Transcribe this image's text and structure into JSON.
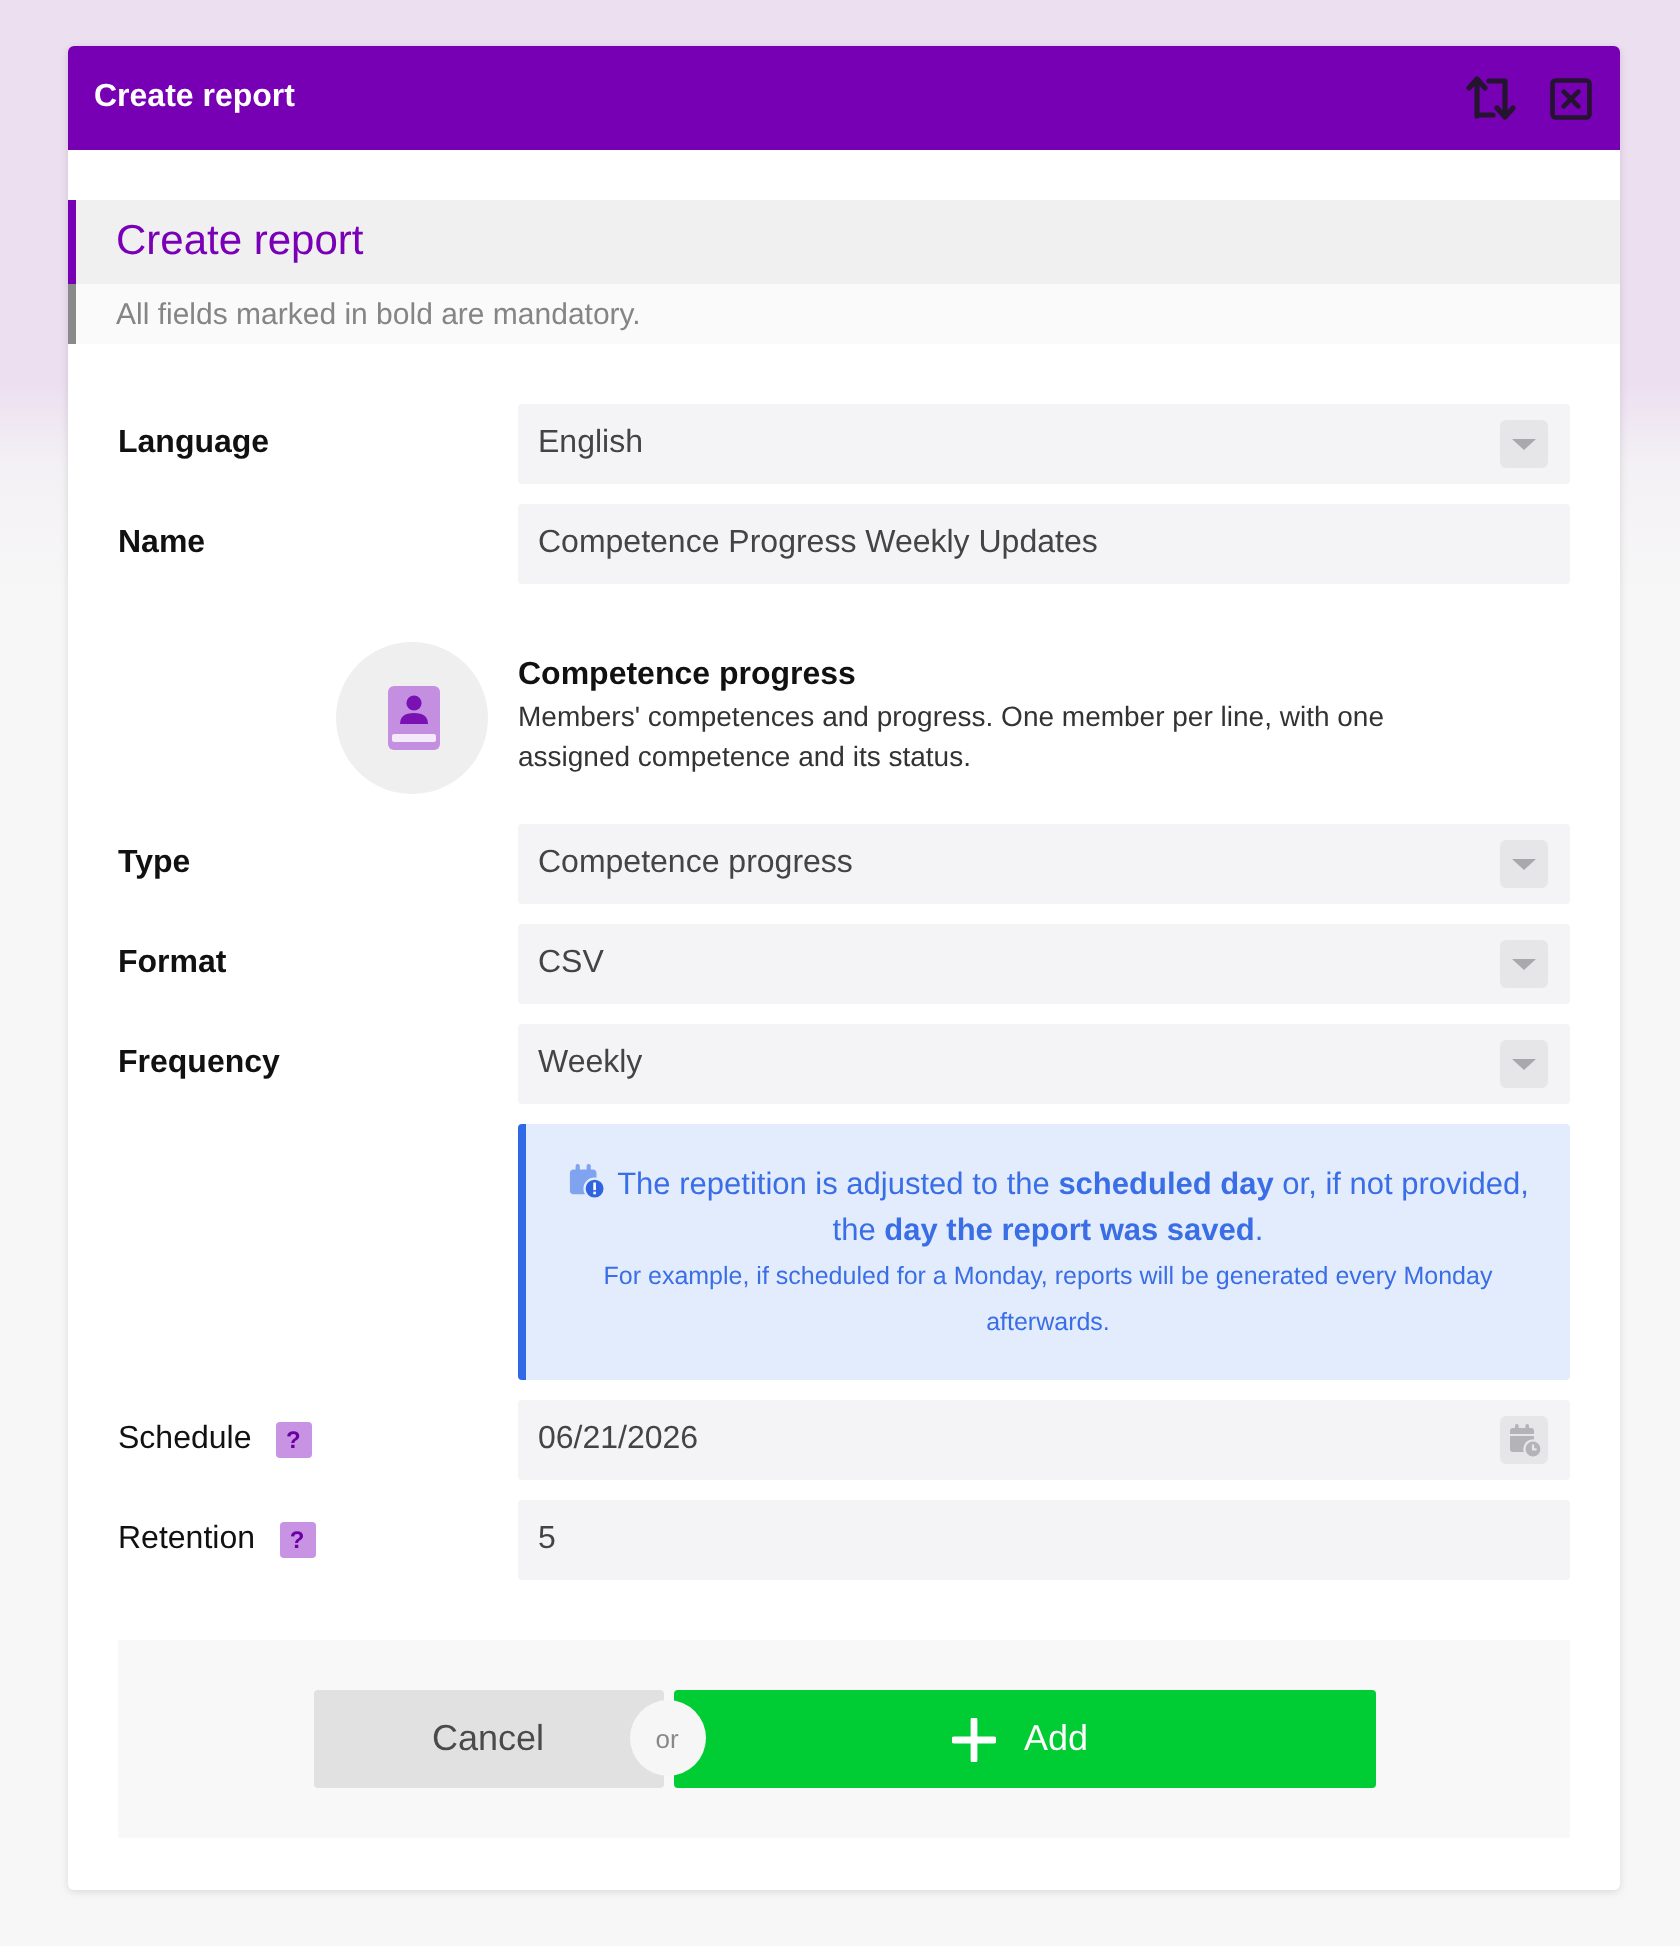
{
  "dialog": {
    "title": "Create report"
  },
  "section": {
    "title": "Create report",
    "subtitle": "All fields marked in bold are mandatory."
  },
  "fields": [
    {
      "kind": "select",
      "label": "Language",
      "required": true,
      "value": "English"
    },
    {
      "kind": "text",
      "label": "Name",
      "required": true,
      "value": "Competence Progress Weekly Updates"
    },
    {
      "kind": "description",
      "title": "Competence progress",
      "text": "Members' competences and progress. One member per line, with one assigned competence and its status."
    },
    {
      "kind": "select",
      "label": "Type",
      "required": true,
      "value": "Competence progress"
    },
    {
      "kind": "select",
      "label": "Format",
      "required": true,
      "value": "CSV"
    },
    {
      "kind": "select",
      "label": "Frequency",
      "required": true,
      "value": "Weekly"
    },
    {
      "kind": "info",
      "text": "The repetition is adjusted to the **scheduled day** or, if not provided, the **day the report was saved**.",
      "note": "For example, if scheduled for a Monday, reports will be generated every Monday afterwards."
    },
    {
      "kind": "date",
      "label": "Schedule",
      "required": false,
      "help": "?",
      "value": "06/21/2026"
    },
    {
      "kind": "text",
      "label": "Retention",
      "required": false,
      "help": "?",
      "value": "5"
    }
  ],
  "footer": {
    "cancel": "Cancel",
    "separator": "or",
    "submit": "Add"
  }
}
